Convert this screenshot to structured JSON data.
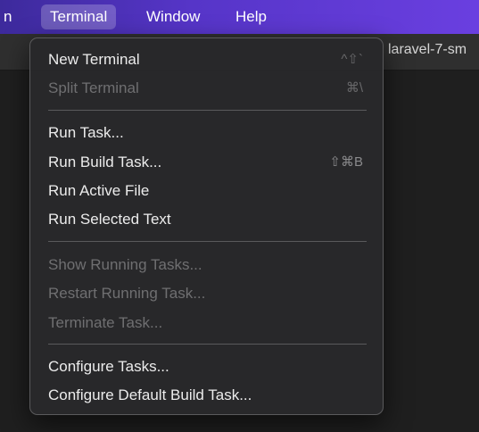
{
  "menubar": {
    "items": [
      "n",
      "Terminal",
      "Window",
      "Help"
    ]
  },
  "tab": {
    "title": "laravel-7-sm"
  },
  "menu": {
    "new_terminal": "New Terminal",
    "new_terminal_shortcut": "^⇧`",
    "split_terminal": "Split Terminal",
    "split_terminal_shortcut": "⌘\\",
    "run_task": "Run Task...",
    "run_build_task": "Run Build Task...",
    "run_build_task_shortcut": "⇧⌘B",
    "run_active_file": "Run Active File",
    "run_selected_text": "Run Selected Text",
    "show_running_tasks": "Show Running Tasks...",
    "restart_running_task": "Restart Running Task...",
    "terminate_task": "Terminate Task...",
    "configure_tasks": "Configure Tasks...",
    "configure_default_build_task": "Configure Default Build Task..."
  }
}
